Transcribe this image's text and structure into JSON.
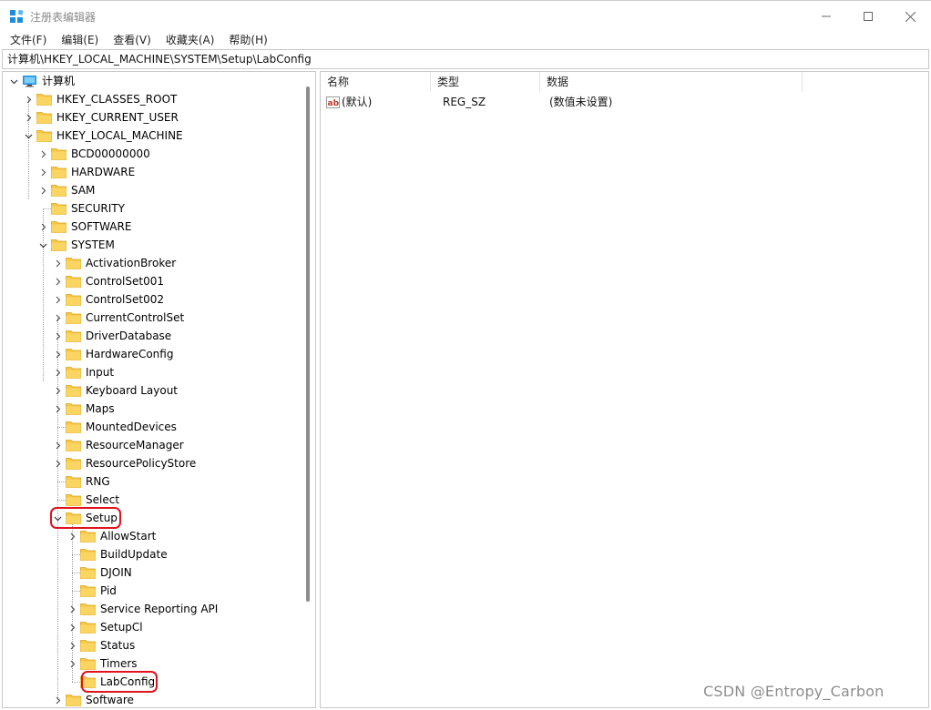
{
  "window": {
    "title": "注册表编辑器",
    "icon": "registry-editor-icon",
    "controls": [
      "minimize-icon",
      "maximize-icon",
      "close-icon"
    ]
  },
  "menu": {
    "items": [
      "文件(F)",
      "编辑(E)",
      "查看(V)",
      "收藏夹(A)",
      "帮助(H)"
    ]
  },
  "address": {
    "path": "计算机\\HKEY_LOCAL_MACHINE\\SYSTEM\\Setup\\LabConfig"
  },
  "tree": {
    "root": "计算机",
    "hkcr": "HKEY_CLASSES_ROOT",
    "hkcu": "HKEY_CURRENT_USER",
    "hklm": "HKEY_LOCAL_MACHINE",
    "hklm_children": [
      "BCD00000000",
      "HARDWARE",
      "SAM",
      "SECURITY",
      "SOFTWARE",
      "SYSTEM"
    ],
    "system_children": [
      "ActivationBroker",
      "ControlSet001",
      "ControlSet002",
      "CurrentControlSet",
      "DriverDatabase",
      "HardwareConfig",
      "Input",
      "Keyboard Layout",
      "Maps",
      "MountedDevices",
      "ResourceManager",
      "ResourcePolicyStore",
      "RNG",
      "Select",
      "Setup",
      "Software"
    ],
    "setup_children": [
      "AllowStart",
      "BuildUpdate",
      "DJOIN",
      "Pid",
      "Service Reporting API",
      "SetupCl",
      "Status",
      "Timers",
      "LabConfig"
    ]
  },
  "list": {
    "columns": [
      "名称",
      "类型",
      "数据"
    ],
    "rows": [
      {
        "name": "(默认)",
        "type": "REG_SZ",
        "data": "(数值未设置)"
      }
    ]
  },
  "colors": {
    "folder": "#f7c845",
    "highlight": "#e0131f",
    "computer_icon": "#1c8ddb"
  },
  "watermark": "CSDN @Entropy_Carbon"
}
